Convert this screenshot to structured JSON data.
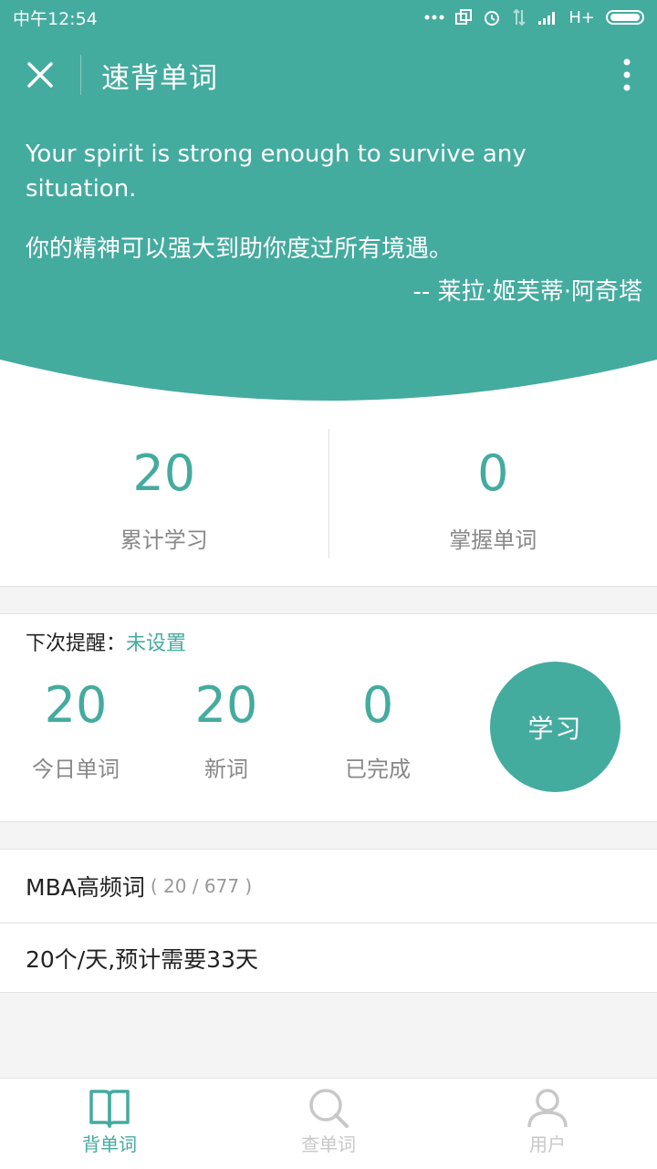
{
  "status_bar": {
    "time": "中午12:54",
    "network": "H+"
  },
  "title_bar": {
    "title": "速背单词"
  },
  "quote": {
    "english": "Your spirit is strong enough to survive any situation.",
    "chinese": "你的精神可以强大到助你度过所有境遇。",
    "author": "-- 莱拉·姬芙蒂·阿奇塔"
  },
  "stats": {
    "total_learned": {
      "value": "20",
      "label": "累计学习"
    },
    "mastered": {
      "value": "0",
      "label": "掌握单词"
    }
  },
  "plan": {
    "reminder_label": "下次提醒：",
    "reminder_value": "未设置",
    "today_words": {
      "value": "20",
      "label": "今日单词"
    },
    "new_words": {
      "value": "20",
      "label": "新词"
    },
    "completed": {
      "value": "0",
      "label": "已完成"
    },
    "study_button": "学习"
  },
  "book": {
    "name": "MBA高频词",
    "progress": "( 20 / 677 )",
    "schedule": "20个/天,预计需要33天"
  },
  "tabs": [
    {
      "label": "背单词",
      "icon": "book-icon",
      "active": true
    },
    {
      "label": "查单词",
      "icon": "search-icon",
      "active": false
    },
    {
      "label": "用户",
      "icon": "user-icon",
      "active": false
    }
  ],
  "colors": {
    "accent": "#44ab9f",
    "muted": "#888888",
    "inactive": "#c8c8c8"
  }
}
